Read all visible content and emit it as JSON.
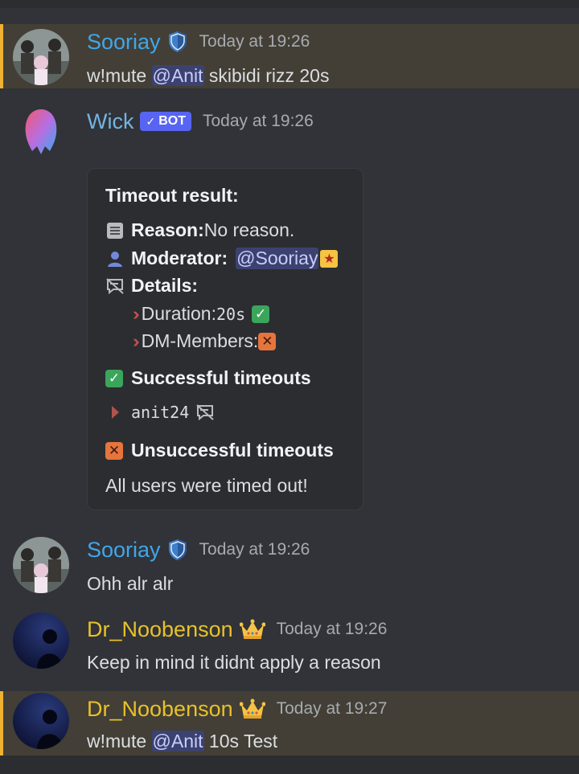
{
  "colors": {
    "background": "#313338",
    "highlight": "#433f36",
    "highlight_bar": "#f0b232",
    "mention": "#3c4270",
    "bot_tag": "#5865f2"
  },
  "messages": [
    {
      "author": "Sooriay",
      "badge_icon": "shield-icon",
      "timestamp": "Today at 19:26",
      "text_prefix": "w!mute ",
      "mention": "@Anit",
      "text_suffix": " skibidi rizz 20s"
    },
    {
      "author": "Wick",
      "bot_tag": "BOT",
      "timestamp": "Today at 19:26"
    },
    {
      "author": "Sooriay",
      "badge_icon": "shield-icon",
      "timestamp": "Today at 19:26",
      "text": "Ohh alr alr"
    },
    {
      "author": "Dr_Noobenson",
      "badge_icon": "crown-icon",
      "timestamp": "Today at 19:26",
      "text": "Keep in mind it didnt apply a reason"
    },
    {
      "author": "Dr_Noobenson",
      "badge_icon": "crown-icon",
      "timestamp": "Today at 19:27",
      "text_prefix": "w!mute ",
      "mention": "@Anit",
      "text_suffix": " 10s Test"
    }
  ],
  "embed": {
    "title": "Timeout result:",
    "reason_label": "Reason:",
    "reason_value": " No reason.",
    "moderator_label": "Moderator:",
    "moderator_mention": "@Sooriay",
    "details_label": "Details:",
    "duration_label": "Duration: ",
    "duration_value": "20s",
    "dm_label": "DM-Members: ",
    "success_title": "Successful timeouts",
    "success_user": "anit24",
    "fail_title": "Unsuccessful timeouts",
    "footer": "All users were timed out!"
  }
}
